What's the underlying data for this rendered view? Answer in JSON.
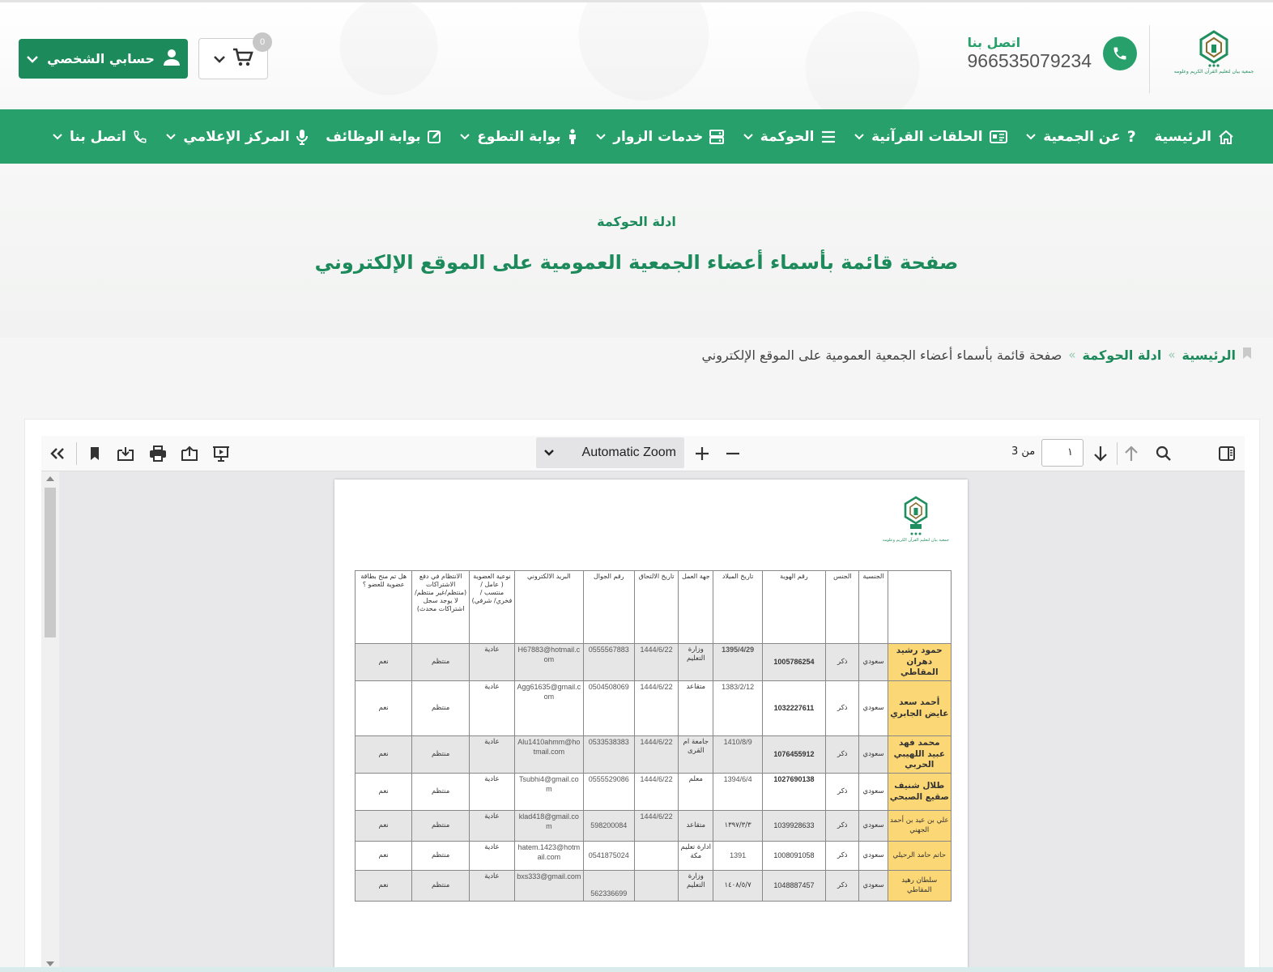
{
  "header": {
    "contact_label": "اتصل بنا",
    "contact_phone": "966535079234",
    "account_label": "حسابي الشخصي",
    "cart_count": "0",
    "logo_caption": "جمعية بيان لتعليم القرآن الكريم وعلومه"
  },
  "nav": {
    "items": [
      {
        "label": "الرئيسية",
        "icon": "home-icon"
      },
      {
        "label": "عن الجمعية",
        "icon": "question-icon"
      },
      {
        "label": "الحلقات القرآنية",
        "icon": "id-card-icon"
      },
      {
        "label": "الحوكمة",
        "icon": "list-icon"
      },
      {
        "label": "خدمات الزوار",
        "icon": "server-icon"
      },
      {
        "label": "بوابة التطوع",
        "icon": "person-icon"
      },
      {
        "label": "بوابة الوظائف",
        "icon": "edit-icon"
      },
      {
        "label": "المركز الإعلامي",
        "icon": "microphone-icon"
      },
      {
        "label": "اتصل بنا",
        "icon": "phone-icon"
      }
    ]
  },
  "hero": {
    "subtitle": "ادلة الحوكمة",
    "title": "صفحة قائمة بأسماء أعضاء الجمعية العمومية على الموقع الإلكتروني"
  },
  "breadcrumb": {
    "home": "الرئيسية",
    "parent": "ادلة الحوكمة",
    "current": "صفحة قائمة بأسماء أعضاء الجمعية العمومية على الموقع الإلكتروني",
    "separator": "»"
  },
  "viewer": {
    "zoom_label": "Automatic Zoom",
    "page_value": "١",
    "page_of": "من 3"
  },
  "table": {
    "headers": [
      "",
      "الجنسية",
      "الجنس",
      "رقم الهوية",
      "تاريخ الميلاد",
      "جهة العمل",
      "تاريخ الالتحاق",
      "رقم الجوال",
      "البريد الالكتروني",
      "نوعية العضوية ( عامل / منتسب /فخري/ شرفي)",
      "الانتظام في دفع الاشتراكات (منتظم/غير منتظم/ لا يوجد سجل اشتراكات محدث)",
      "هل تم منح بطاقة عضوية للعضو ؟"
    ],
    "rows": [
      {
        "name": "حمود رشيد دهران المقاطي",
        "nationality": "سعودي",
        "gender": "ذكر",
        "id": "1005786254",
        "dob": "1395/4/29",
        "employer": "وزارة التعليم",
        "joined": "1444/6/22",
        "mobile": "0555567883",
        "email": "H67883@hotmail.com",
        "type": "عادية",
        "regular": "منتظم",
        "card": "نعم"
      },
      {
        "name": "أحمد سعد عايض الجابري",
        "nationality": "سعودي",
        "gender": "ذكر",
        "id": "1032227611",
        "dob": "1383/2/12",
        "employer": "متقاعد",
        "joined": "1444/6/22",
        "mobile": "0504508069",
        "email": "Agg61635@gmail.com",
        "type": "عادية",
        "regular": "منتظم",
        "card": "نعم"
      },
      {
        "name": "محمد فهد عبيد اللهيبي الحربي",
        "nationality": "سعودي",
        "gender": "ذكر",
        "id": "1076455912",
        "dob": "1410/8/9",
        "employer": "جامعة ام القرى",
        "joined": "1444/6/22",
        "mobile": "0533538383",
        "email": "Alu1410ahmm@hotmail.com",
        "type": "عادية",
        "regular": "منتظم",
        "card": "نعم"
      },
      {
        "name": "طلال شنيف صقيع الصبحي",
        "nationality": "سعودي",
        "gender": "ذكر",
        "id": "1027690138",
        "dob": "1394/6/4",
        "employer": "معلم",
        "joined": "1444/6/22",
        "mobile": "0555529086",
        "email": "Tsubhi4@gmail.com",
        "type": "عادية",
        "regular": "منتظم",
        "card": "نعم"
      },
      {
        "name": "علي بن عيد بن أحمد الجهني",
        "nationality": "سعودي",
        "gender": "ذكر",
        "id": "1039928633",
        "dob": "١٣٩٧/٣/٣",
        "employer": "متقاعد",
        "joined": "1444/6/22",
        "mobile": "598200084",
        "email": "klad418@gmail.com",
        "type": "عادية",
        "regular": "منتظم",
        "card": "نعم"
      },
      {
        "name": "حاتم حامد الرحيلي",
        "nationality": "سعودي",
        "gender": "ذكر",
        "id": "1008091058",
        "dob": "1391",
        "employer": "ادارة تعليم مكة",
        "joined": "",
        "mobile": "0541875024",
        "email": "hatem.1423@hotmail.com",
        "type": "عادية",
        "regular": "منتظم",
        "card": "نعم"
      },
      {
        "name": "سلطان رهيد المقاطي",
        "nationality": "سعودي",
        "gender": "ذكر",
        "id": "1048887457",
        "dob": "١٤٠٨/٥/٧",
        "employer": "وزارة التعليم",
        "joined": "",
        "mobile": "562336699",
        "email": "bxs333@gmail.com",
        "type": "عادية",
        "regular": "منتظم",
        "card": "نعم"
      }
    ]
  },
  "colors": {
    "brand_green": "#27a06b",
    "dark_green": "#1d8a5c",
    "name_highlight": "#fcd775"
  }
}
